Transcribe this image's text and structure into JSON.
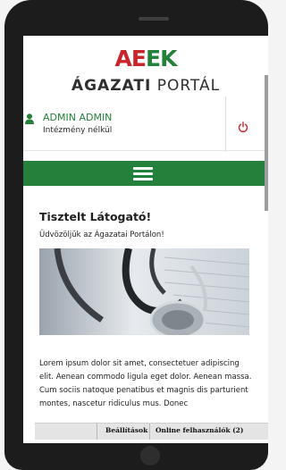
{
  "logo": {
    "mark": [
      "A",
      "E",
      "E",
      "K"
    ],
    "portal_bold": "ÁGAZATI",
    "portal_rest": "PORTÁL"
  },
  "user": {
    "name": "ADMIN ADMIN",
    "institution": "Intézmény nélkül"
  },
  "main": {
    "greeting": "Tisztelt Látogató!",
    "welcome": "Üdvözöljük az Ágazatai Portálon!",
    "body": "Lorem ipsum dolor sit amet, consectetuer adipiscing elit. Aenean commodo ligula eget dolor. Aenean massa. Cum sociis natoque penatibus et magnis dis parturient montes, nascetur ridiculus mus. Donec"
  },
  "footer": {
    "settings_label": "Beállítások",
    "online_users_label": "Online felhasználók (2)"
  },
  "colors": {
    "brand_green": "#24803a",
    "brand_red": "#c9262c"
  },
  "icons": {
    "user": "user-icon",
    "power": "power-icon",
    "menu": "hamburger-menu-icon"
  }
}
